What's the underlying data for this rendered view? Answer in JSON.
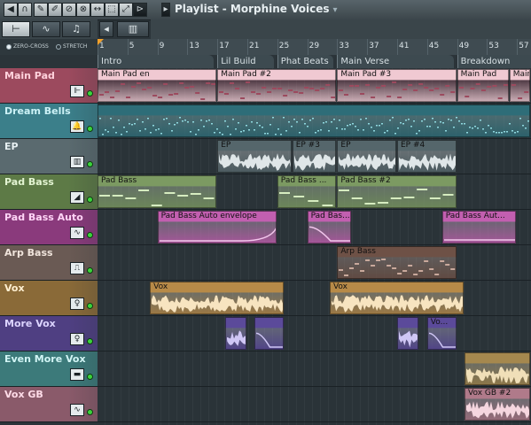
{
  "toolbar": {
    "title": "Playlist - Morphine Voices",
    "tools": [
      {
        "icon": "snap-icon",
        "glyph": "◀"
      },
      {
        "icon": "magnet-icon",
        "glyph": "∩"
      },
      {
        "icon": "draw-icon",
        "glyph": "✎"
      },
      {
        "icon": "paint-icon",
        "glyph": "✐"
      },
      {
        "icon": "delete-icon",
        "glyph": "⊘"
      },
      {
        "icon": "mute-icon",
        "glyph": "⊗"
      },
      {
        "icon": "slip-icon",
        "glyph": "↔"
      },
      {
        "icon": "select-icon",
        "glyph": "⬚"
      },
      {
        "icon": "zoom-icon",
        "glyph": "⤢"
      },
      {
        "icon": "playback-icon",
        "glyph": "⊳"
      }
    ],
    "title_arrow": "▾"
  },
  "subbar": {
    "buttons": [
      {
        "icon": "pattern-icon",
        "glyph": "⊢"
      },
      {
        "icon": "automation-icon",
        "glyph": "∿"
      },
      {
        "icon": "note-icon",
        "glyph": "♫"
      },
      {
        "icon": "scroll-left-icon",
        "glyph": "◂"
      },
      {
        "icon": "scroll-track-icon",
        "glyph": "▥"
      }
    ]
  },
  "options": {
    "zero_cross": "ZERO-CROSS",
    "stretch": "STRETCH"
  },
  "ruler": {
    "bars": [
      "1",
      "5",
      "9",
      "13",
      "17",
      "21",
      "25",
      "29",
      "33",
      "37",
      "41",
      "45",
      "49",
      "53",
      "57"
    ]
  },
  "markers": [
    {
      "label": "Intro"
    },
    {
      "label": "Lil Build"
    },
    {
      "label": "Phat Beats"
    },
    {
      "label": "Main Verse"
    },
    {
      "label": "Breakdown"
    }
  ],
  "tracks": [
    {
      "name": "Main Pad",
      "color": "#9c4a5e",
      "text": "#ffd2dc",
      "icon": "piano-roll-icon",
      "glyph": "⊩"
    },
    {
      "name": "Dream Bells",
      "color": "#3b7f8a",
      "text": "#ccf2f6",
      "icon": "bell-icon",
      "glyph": "🔔"
    },
    {
      "name": "EP",
      "color": "#5a6a6f",
      "text": "#e7f0f2",
      "icon": "keyboard-icon",
      "glyph": "▥"
    },
    {
      "name": "Pad Bass",
      "color": "#5d7a46",
      "text": "#e3f4d2",
      "icon": "ramp-icon",
      "glyph": "◢"
    },
    {
      "name": "Pad Bass Auto",
      "color": "#8a3a7c",
      "text": "#ffd4f6",
      "icon": "automation-clip-icon",
      "glyph": "∿"
    },
    {
      "name": "Arp Bass",
      "color": "#6a5a54",
      "text": "#f0e4dc",
      "icon": "arp-icon",
      "glyph": "⎍"
    },
    {
      "name": "Vox",
      "color": "#8a6a38",
      "text": "#fff0d2",
      "icon": "vocal-icon",
      "glyph": "♀"
    },
    {
      "name": "More Vox",
      "color": "#4f3f82",
      "text": "#dcd4ff",
      "icon": "vocal-icon",
      "glyph": "♀"
    },
    {
      "name": "Even More Vox",
      "color": "#3c7a7a",
      "text": "#d2f5f5",
      "icon": "sample-icon",
      "glyph": "▬"
    },
    {
      "name": "Vox GB",
      "color": "#8a5a6a",
      "text": "#ffdce8",
      "icon": "automation-clip-icon",
      "glyph": "∿"
    }
  ],
  "clips": [
    {
      "track": 0,
      "start": 1,
      "end": 17,
      "label": "Main Pad en",
      "color": "#f0c9d2",
      "fill": "#9c4a5e",
      "kind": "notes"
    },
    {
      "track": 0,
      "start": 17,
      "end": 33,
      "label": "Main Pad #2",
      "color": "#f0c9d2",
      "fill": "#9c4a5e",
      "kind": "notes"
    },
    {
      "track": 0,
      "start": 33,
      "end": 49,
      "label": "Main Pad #3",
      "color": "#f0c9d2",
      "fill": "#9c4a5e",
      "kind": "notes"
    },
    {
      "track": 0,
      "start": 49,
      "end": 56,
      "label": "Main Pad",
      "color": "#f0c9d2",
      "fill": "#9c4a5e",
      "kind": "notes"
    },
    {
      "track": 0,
      "start": 56,
      "end": 60,
      "label": "Main",
      "color": "#f0c9d2",
      "fill": "#9c4a5e",
      "kind": "notes"
    },
    {
      "track": 1,
      "start": 1,
      "end": 61,
      "label": "",
      "color": "#2e6d78",
      "fill": "#8fd8df",
      "kind": "bells"
    },
    {
      "track": 2,
      "start": 17,
      "end": 27,
      "label": "EP",
      "color": "#55666b",
      "fill": "#dfe6e8",
      "kind": "wave"
    },
    {
      "track": 2,
      "start": 27,
      "end": 33,
      "label": "EP #3",
      "color": "#55666b",
      "fill": "#dfe6e8",
      "kind": "wave"
    },
    {
      "track": 2,
      "start": 33,
      "end": 41,
      "label": "EP",
      "color": "#55666b",
      "fill": "#dfe6e8",
      "kind": "wave"
    },
    {
      "track": 2,
      "start": 41,
      "end": 49,
      "label": "EP #4",
      "color": "#55666b",
      "fill": "#dfe6e8",
      "kind": "wave"
    },
    {
      "track": 3,
      "start": 1,
      "end": 17,
      "label": "Pad Bass",
      "color": "#7c9a62",
      "fill": "#d6ecc0",
      "kind": "bass"
    },
    {
      "track": 3,
      "start": 25,
      "end": 33,
      "label": "Pad Bass ...",
      "color": "#7c9a62",
      "fill": "#d6ecc0",
      "kind": "bass"
    },
    {
      "track": 3,
      "start": 33,
      "end": 49,
      "label": "Pad Bass #2",
      "color": "#7c9a62",
      "fill": "#d6ecc0",
      "kind": "bass"
    },
    {
      "track": 4,
      "start": 9,
      "end": 25,
      "label": "Pad Bass Auto envelope",
      "color": "#c25fb0",
      "fill": "#f2c7ec",
      "kind": "auto-up"
    },
    {
      "track": 4,
      "start": 29,
      "end": 35,
      "label": "Pad Bas...",
      "color": "#c25fb0",
      "fill": "#f2c7ec",
      "kind": "auto-down"
    },
    {
      "track": 4,
      "start": 47,
      "end": 57,
      "label": "Pad Bass Aut...",
      "color": "#c25fb0",
      "fill": "#f2c7ec",
      "kind": "auto-flat"
    },
    {
      "track": 5,
      "start": 33,
      "end": 49,
      "label": "Arp Bass",
      "color": "#6e5146",
      "fill": "#c9a99c",
      "kind": "arp"
    },
    {
      "track": 6,
      "start": 8,
      "end": 26,
      "label": "Vox",
      "color": "#b78a48",
      "fill": "#f7e4c0",
      "kind": "wave"
    },
    {
      "track": 6,
      "start": 32,
      "end": 50,
      "label": "Vox",
      "color": "#b78a48",
      "fill": "#f7e4c0",
      "kind": "wave"
    },
    {
      "track": 7,
      "start": 18,
      "end": 21,
      "label": "",
      "color": "#5b4a9a",
      "fill": "#cfc6f5",
      "kind": "wave"
    },
    {
      "track": 7,
      "start": 22,
      "end": 26,
      "label": "",
      "color": "#5b4a9a",
      "fill": "#cfc6f5",
      "kind": "auto-down"
    },
    {
      "track": 7,
      "start": 41,
      "end": 44,
      "label": "",
      "color": "#5b4a9a",
      "fill": "#cfc6f5",
      "kind": "wave"
    },
    {
      "track": 7,
      "start": 45,
      "end": 49,
      "label": "Vo...",
      "color": "#5b4a9a",
      "fill": "#cfc6f5",
      "kind": "auto-down"
    },
    {
      "track": 8,
      "start": 50,
      "end": 61,
      "label": "",
      "color": "#a5884e",
      "fill": "#f0dfb8",
      "kind": "wave"
    },
    {
      "track": 9,
      "start": 50,
      "end": 61,
      "label": "Vox GB #2",
      "color": "#b07a8a",
      "fill": "#f5d6df",
      "kind": "wave"
    }
  ]
}
